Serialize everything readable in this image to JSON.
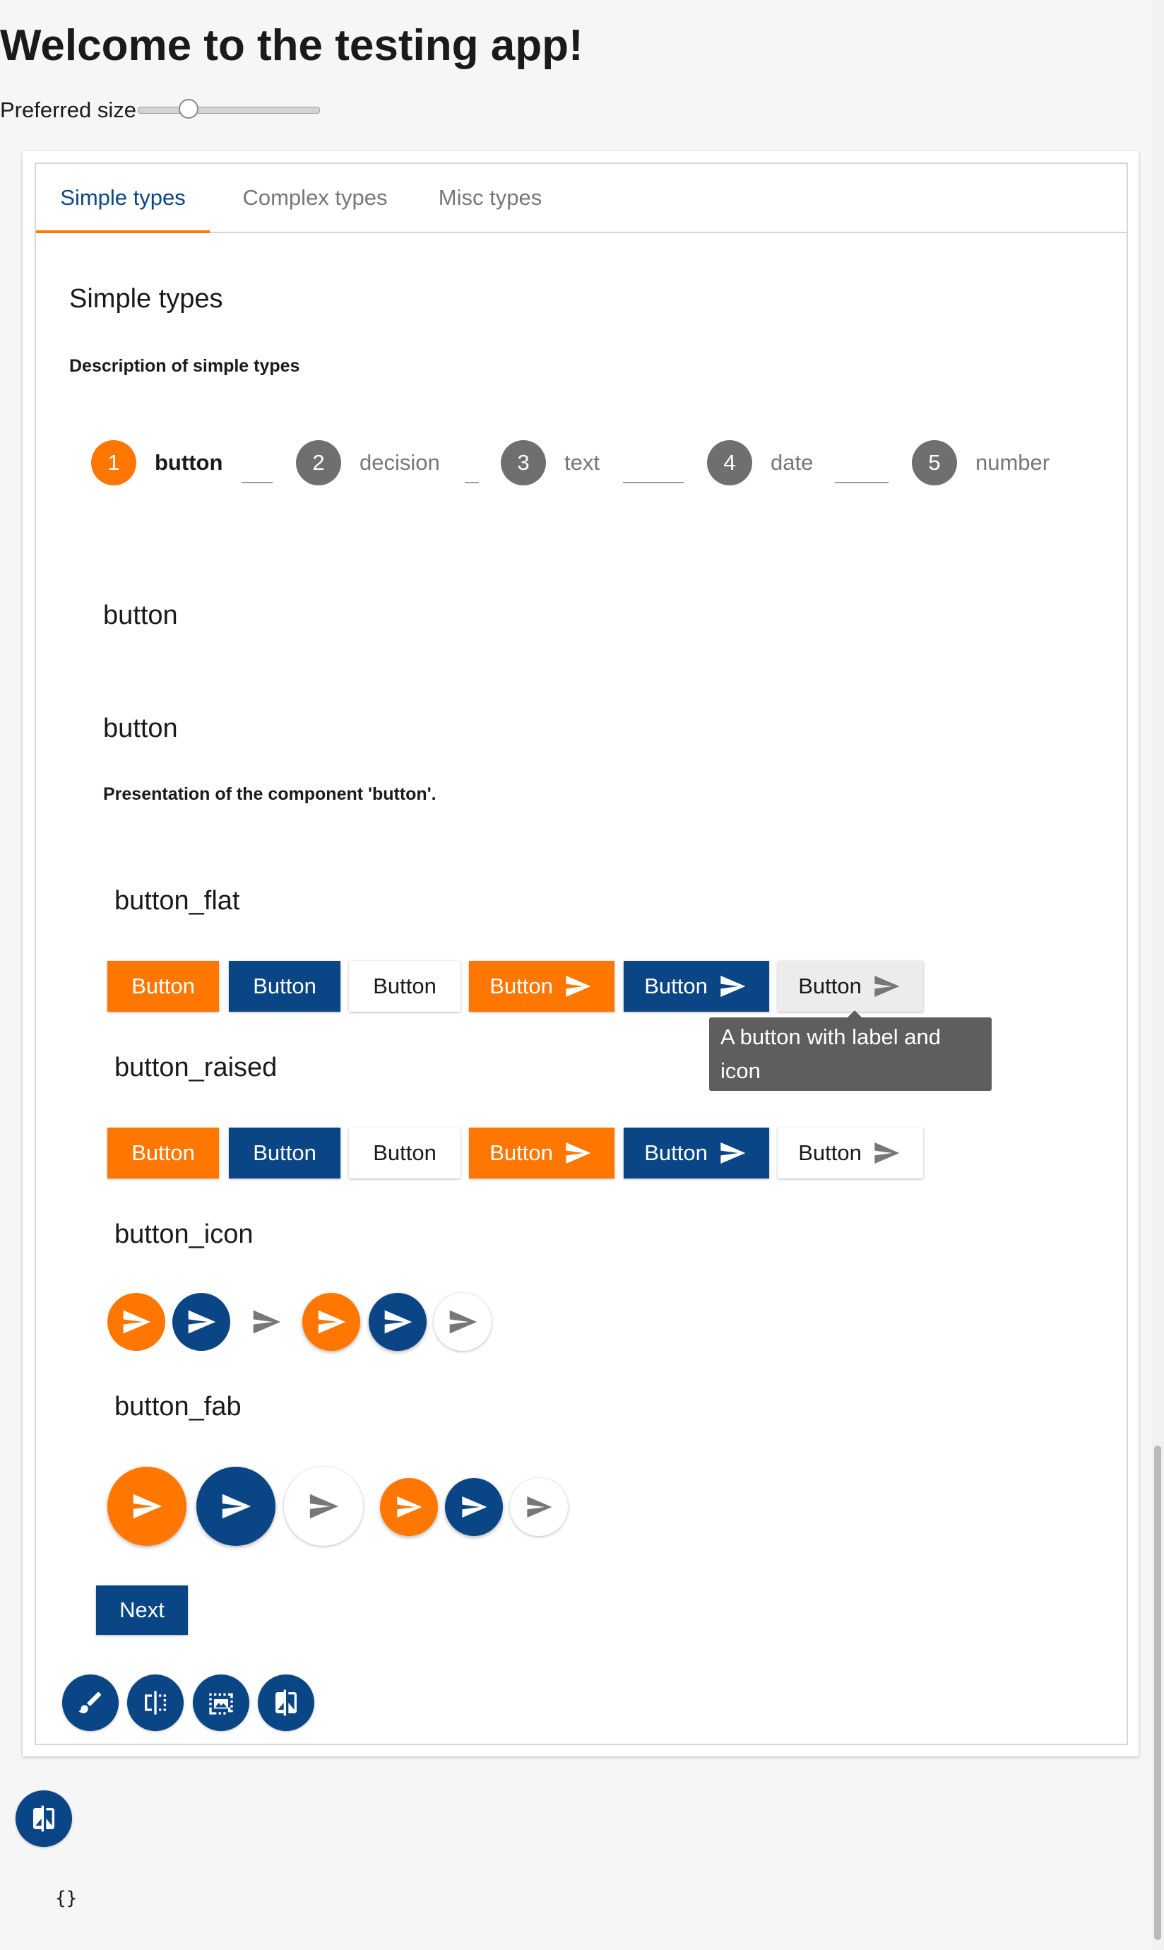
{
  "app": {
    "title": "Welcome to the testing app!"
  },
  "preferred_size": {
    "label": "Preferred size",
    "value_fraction": 0.28
  },
  "tabs": [
    {
      "label": "Simple types",
      "active": true
    },
    {
      "label": "Complex types",
      "active": false
    },
    {
      "label": "Misc types",
      "active": false
    }
  ],
  "section": {
    "title": "Simple types",
    "description": "Description of simple types"
  },
  "stepper": [
    {
      "number": "1",
      "label": "button",
      "active": true
    },
    {
      "number": "2",
      "label": "decision",
      "active": false
    },
    {
      "number": "3",
      "label": "text",
      "active": false
    },
    {
      "number": "4",
      "label": "date",
      "active": false
    },
    {
      "number": "5",
      "label": "number",
      "active": false
    }
  ],
  "component": {
    "step_title": "button",
    "name": "button",
    "presentation": "Presentation of the component 'button'."
  },
  "groups": {
    "flat": "button_flat",
    "raised": "button_raised",
    "icon": "button_icon",
    "fab": "button_fab"
  },
  "button_label": "Button",
  "tooltip": "A button with label and icon",
  "next_label": "Next",
  "json_output": "{}",
  "colors": {
    "orange": "#ff7700",
    "blue": "#0a4585",
    "grey_icon": "#777777"
  },
  "icons": {
    "send": "send-icon",
    "toolbar": [
      "brush-icon",
      "split-view-icon",
      "image-frame-icon",
      "compare-icon"
    ],
    "floating": "compare-icon"
  }
}
